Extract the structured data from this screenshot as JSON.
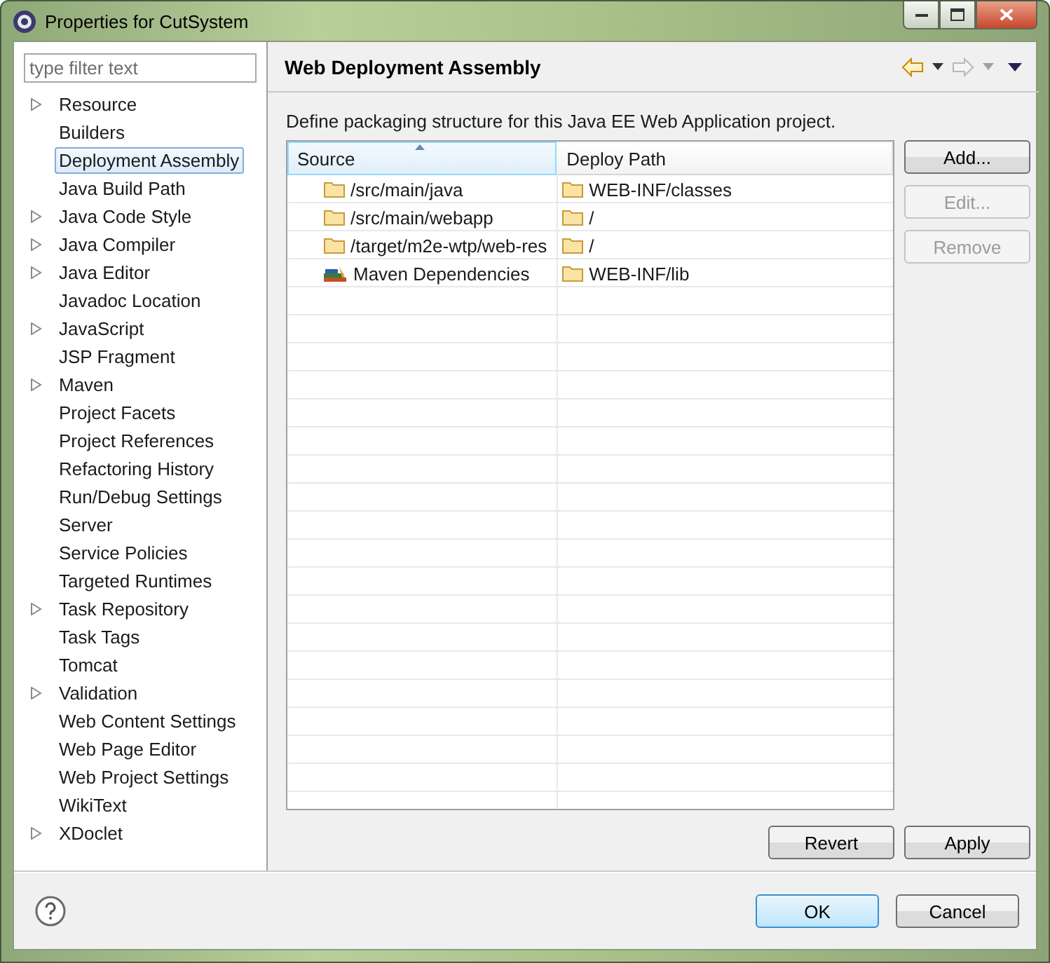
{
  "window": {
    "title": "Properties for CutSystem"
  },
  "filter": {
    "placeholder": "type filter text"
  },
  "tree": [
    {
      "label": "Resource",
      "expandable": true,
      "selected": false
    },
    {
      "label": "Builders",
      "expandable": false,
      "selected": false
    },
    {
      "label": "Deployment Assembly",
      "expandable": false,
      "selected": true
    },
    {
      "label": "Java Build Path",
      "expandable": false,
      "selected": false
    },
    {
      "label": "Java Code Style",
      "expandable": true,
      "selected": false
    },
    {
      "label": "Java Compiler",
      "expandable": true,
      "selected": false
    },
    {
      "label": "Java Editor",
      "expandable": true,
      "selected": false
    },
    {
      "label": "Javadoc Location",
      "expandable": false,
      "selected": false
    },
    {
      "label": "JavaScript",
      "expandable": true,
      "selected": false
    },
    {
      "label": "JSP Fragment",
      "expandable": false,
      "selected": false
    },
    {
      "label": "Maven",
      "expandable": true,
      "selected": false
    },
    {
      "label": "Project Facets",
      "expandable": false,
      "selected": false
    },
    {
      "label": "Project References",
      "expandable": false,
      "selected": false
    },
    {
      "label": "Refactoring History",
      "expandable": false,
      "selected": false
    },
    {
      "label": "Run/Debug Settings",
      "expandable": false,
      "selected": false
    },
    {
      "label": "Server",
      "expandable": false,
      "selected": false
    },
    {
      "label": "Service Policies",
      "expandable": false,
      "selected": false
    },
    {
      "label": "Targeted Runtimes",
      "expandable": false,
      "selected": false
    },
    {
      "label": "Task Repository",
      "expandable": true,
      "selected": false
    },
    {
      "label": "Task Tags",
      "expandable": false,
      "selected": false
    },
    {
      "label": "Tomcat",
      "expandable": false,
      "selected": false
    },
    {
      "label": "Validation",
      "expandable": true,
      "selected": false
    },
    {
      "label": "Web Content Settings",
      "expandable": false,
      "selected": false
    },
    {
      "label": "Web Page Editor",
      "expandable": false,
      "selected": false
    },
    {
      "label": "Web Project Settings",
      "expandable": false,
      "selected": false
    },
    {
      "label": "WikiText",
      "expandable": false,
      "selected": false
    },
    {
      "label": "XDoclet",
      "expandable": true,
      "selected": false
    }
  ],
  "page": {
    "title": "Web Deployment Assembly",
    "nav": [
      {
        "kind": "back",
        "disabled": false
      },
      {
        "kind": "forward",
        "disabled": true
      }
    ],
    "description": "Define packaging structure for this Java EE Web Application project."
  },
  "table": {
    "columns": [
      {
        "label": "Source",
        "sorted": true
      },
      {
        "label": "Deploy Path",
        "sorted": false
      }
    ],
    "rows": [
      {
        "source": "/src/main/java",
        "kind": "folder",
        "deploy_path": "WEB-INF/classes"
      },
      {
        "source": "/src/main/webapp",
        "kind": "folder",
        "deploy_path": "/"
      },
      {
        "source": "/target/m2e-wtp/web-res",
        "kind": "folder",
        "deploy_path": "/"
      },
      {
        "source": "Maven Dependencies",
        "kind": "library",
        "deploy_path": "WEB-INF/lib"
      }
    ]
  },
  "side_buttons": [
    {
      "label": "Add...",
      "disabled": false
    },
    {
      "label": "Edit...",
      "disabled": true
    },
    {
      "label": "Remove",
      "disabled": true
    }
  ],
  "page_buttons": [
    "Revert",
    "Apply"
  ],
  "dialog_buttons": [
    {
      "label": "OK",
      "default": true
    },
    {
      "label": "Cancel",
      "default": false
    }
  ]
}
